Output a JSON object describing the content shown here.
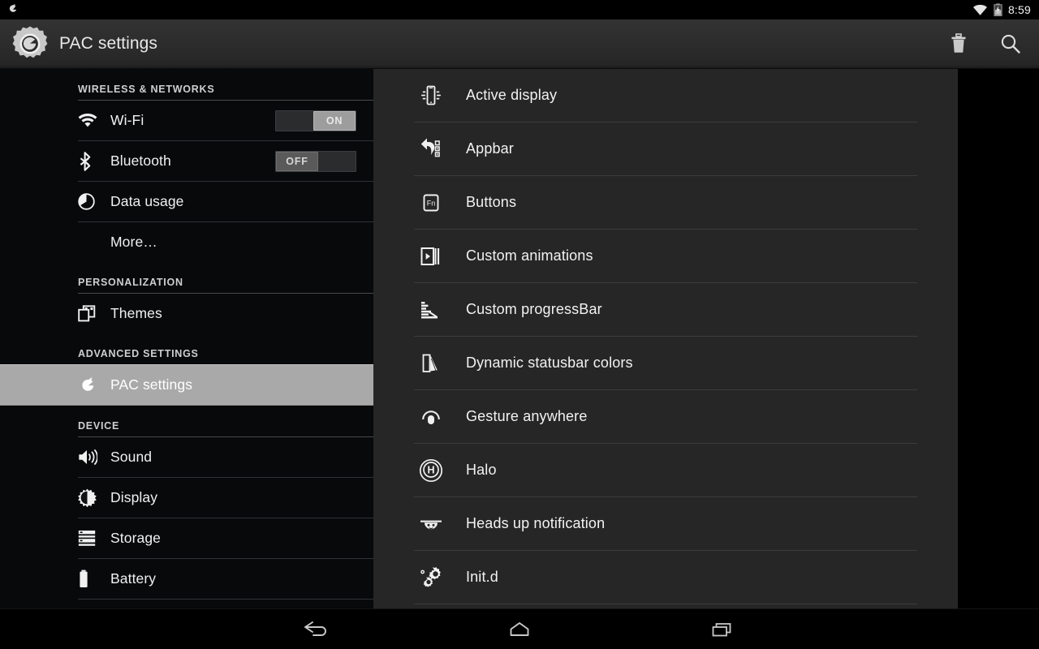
{
  "status_bar": {
    "notification_icon": "pacman-icon",
    "wifi_icon": "wifi-icon",
    "battery_icon": "battery-charging-icon",
    "time": "8:59"
  },
  "action_bar": {
    "app_icon": "settings-gear-pacman-icon",
    "title": "PAC settings",
    "actions": [
      {
        "name": "delete-action",
        "icon": "trash-icon"
      },
      {
        "name": "search-action",
        "icon": "search-icon"
      }
    ]
  },
  "sidebar": {
    "sections": [
      {
        "header": "WIRELESS & NETWORKS",
        "items": [
          {
            "label": "Wi-Fi",
            "icon": "wifi-icon",
            "toggle": "ON"
          },
          {
            "label": "Bluetooth",
            "icon": "bluetooth-icon",
            "toggle": "OFF"
          },
          {
            "label": "Data usage",
            "icon": "data-usage-icon"
          },
          {
            "label": "More…",
            "icon": null
          }
        ]
      },
      {
        "header": "PERSONALIZATION",
        "items": [
          {
            "label": "Themes",
            "icon": "themes-icon"
          }
        ]
      },
      {
        "header": "ADVANCED SETTINGS",
        "items": [
          {
            "label": "PAC settings",
            "icon": "pacman-icon",
            "selected": true
          }
        ]
      },
      {
        "header": "DEVICE",
        "items": [
          {
            "label": "Sound",
            "icon": "speaker-icon"
          },
          {
            "label": "Display",
            "icon": "brightness-icon"
          },
          {
            "label": "Storage",
            "icon": "storage-icon"
          },
          {
            "label": "Battery",
            "icon": "battery-icon"
          }
        ]
      }
    ]
  },
  "panel": {
    "items": [
      {
        "label": "Active display",
        "icon": "active-display-icon"
      },
      {
        "label": "Appbar",
        "icon": "appbar-icon"
      },
      {
        "label": "Buttons",
        "icon": "fn-key-icon"
      },
      {
        "label": "Custom animations",
        "icon": "film-play-icon"
      },
      {
        "label": "Custom progressBar",
        "icon": "progressbar-icon"
      },
      {
        "label": "Dynamic statusbar colors",
        "icon": "color-swatch-icon"
      },
      {
        "label": "Gesture anywhere",
        "icon": "gesture-icon"
      },
      {
        "label": "Halo",
        "icon": "halo-icon"
      },
      {
        "label": "Heads up notification",
        "icon": "heads-up-icon"
      },
      {
        "label": "Init.d",
        "icon": "gears-icon"
      }
    ]
  },
  "nav_bar": {
    "buttons": [
      {
        "name": "back-button",
        "icon": "back-arrow-icon"
      },
      {
        "name": "home-button",
        "icon": "home-icon"
      },
      {
        "name": "recents-button",
        "icon": "recents-icon"
      }
    ]
  },
  "colors": {
    "action_bar": "#2c2c2c",
    "sidebar_bg": "#08090b",
    "panel_bg": "#262626",
    "selection": "#a9a9a9",
    "text_primary": "#f2f2f2",
    "divider": "#3c3c3c"
  }
}
